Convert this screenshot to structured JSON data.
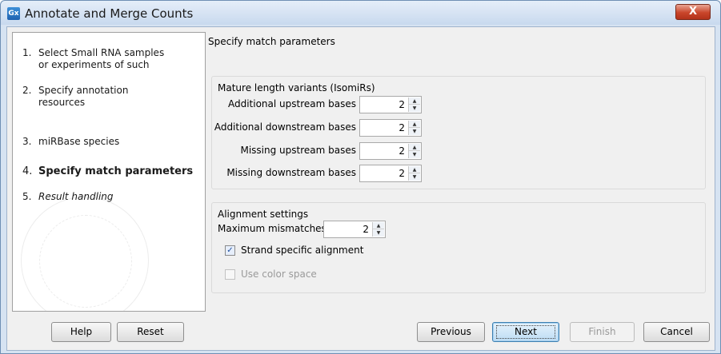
{
  "window": {
    "title": "Annotate and Merge Counts",
    "icon_text": "Gx",
    "close_glyph": "X"
  },
  "steps": [
    {
      "num": "1.",
      "label": "Select Small RNA samples or experiments of such",
      "state": "normal"
    },
    {
      "num": "2.",
      "label": "Specify annotation resources",
      "state": "normal"
    },
    {
      "num": "3.",
      "label": "miRBase species",
      "state": "normal"
    },
    {
      "num": "4.",
      "label": "Specify match parameters",
      "state": "active"
    },
    {
      "num": "5.",
      "label": "Result handling",
      "state": "italic"
    }
  ],
  "panel": {
    "heading": "Specify match parameters",
    "mature_group": {
      "title": "Mature length variants (IsomiRs)",
      "fields": [
        {
          "label": "Additional upstream bases",
          "value": "2"
        },
        {
          "label": "Additional downstream bases",
          "value": "2"
        },
        {
          "label": "Missing upstream bases",
          "value": "2"
        },
        {
          "label": "Missing downstream bases",
          "value": "2"
        }
      ]
    },
    "alignment_group": {
      "title": "Alignment settings",
      "max_mismatches_label": "Maximum mismatches",
      "max_mismatches_value": "2",
      "strand_specific_label": "Strand specific alignment",
      "strand_specific_checked": true,
      "color_space_label": "Use color space",
      "color_space_checked": false,
      "color_space_enabled": false
    }
  },
  "buttons": {
    "help": "Help",
    "reset": "Reset",
    "previous": "Previous",
    "next": "Next",
    "finish": "Finish",
    "cancel": "Cancel"
  },
  "glyphs": {
    "spin_up": "▲",
    "spin_down": "▼",
    "check": "✓"
  },
  "colors": {
    "title_bar": "#c8d9ee",
    "close_button": "#c9452a",
    "default_button_border": "#3c7fb1"
  }
}
